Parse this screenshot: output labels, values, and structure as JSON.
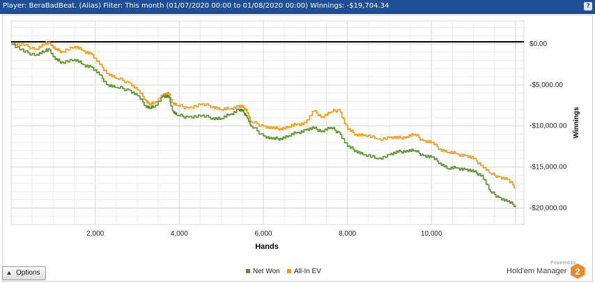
{
  "header": {
    "title": "Player: BeraBadBeat. (Alias) Filter: This month (01/07/2020 00:00 to 01/08/2020 00:00) Winnings: -$19,704.34",
    "help_icon": "question-icon"
  },
  "controls": {
    "options_label": "Options",
    "options_icon": "triangle-up-icon"
  },
  "legend": [
    {
      "name": "Net Won",
      "color": "#5a8f29"
    },
    {
      "name": "All-In EV",
      "color": "#f39a1e"
    }
  ],
  "brand": {
    "powered_by": "Powered by",
    "name": "Hold'em Manager",
    "badge": "2",
    "badge_color": "#f0852c"
  },
  "chart_data": {
    "type": "line",
    "xlabel": "Hands",
    "ylabel": "Winnings",
    "x_ticks": [
      "2,000",
      "4,000",
      "6,000",
      "8,000",
      "10,000"
    ],
    "x_tick_values": [
      2000,
      4000,
      6000,
      8000,
      10000
    ],
    "y_ticks": [
      "$0.00",
      "-$5,000.00",
      "-$10,000.00",
      "-$15,000.00",
      "-$20,000.00"
    ],
    "y_tick_values": [
      0,
      -5000,
      -10000,
      -15000,
      -20000
    ],
    "xlim": [
      0,
      12200
    ],
    "ylim": [
      -22000,
      2800
    ],
    "grid": true,
    "zero_line": true,
    "legend_position": "bottom",
    "series": [
      {
        "name": "Net Won",
        "color": "#5a8f29",
        "x": [
          0,
          300,
          600,
          800,
          900,
          1050,
          1200,
          1500,
          1700,
          1900,
          2100,
          2300,
          2500,
          2800,
          3000,
          3200,
          3300,
          3400,
          3600,
          3750,
          3850,
          3950,
          4200,
          4500,
          4800,
          5000,
          5200,
          5400,
          5500,
          5600,
          5700,
          6000,
          6200,
          6400,
          6600,
          6800,
          7000,
          7200,
          7400,
          7600,
          7800,
          8000,
          8200,
          8400,
          8700,
          9000,
          9200,
          9400,
          9600,
          9800,
          10000,
          10200,
          10400,
          10600,
          10800,
          11000,
          11200,
          11400,
          11600,
          11800,
          12000
        ],
        "y": [
          0,
          -1000,
          -1300,
          -900,
          -600,
          -1900,
          -2200,
          -1900,
          -2500,
          -2800,
          -3800,
          -5000,
          -5300,
          -5600,
          -6300,
          -7500,
          -7800,
          -7700,
          -6400,
          -6500,
          -8200,
          -8700,
          -8900,
          -8800,
          -9000,
          -9100,
          -8600,
          -8000,
          -8200,
          -8700,
          -10000,
          -11200,
          -11600,
          -11500,
          -11200,
          -10800,
          -10500,
          -10300,
          -10600,
          -10200,
          -10800,
          -12500,
          -13000,
          -13500,
          -14000,
          -13500,
          -13200,
          -13000,
          -13000,
          -13600,
          -13800,
          -14500,
          -15200,
          -15100,
          -15300,
          -15600,
          -16000,
          -18000,
          -18700,
          -19200,
          -19704
        ]
      },
      {
        "name": "All-In EV",
        "color": "#f39a1e",
        "x": [
          0,
          300,
          600,
          800,
          900,
          1050,
          1200,
          1500,
          1700,
          1900,
          2100,
          2300,
          2500,
          2800,
          3000,
          3200,
          3300,
          3400,
          3600,
          3750,
          3850,
          3950,
          4200,
          4500,
          4800,
          5000,
          5200,
          5400,
          5500,
          5600,
          5700,
          6000,
          6200,
          6400,
          6600,
          6800,
          7000,
          7200,
          7400,
          7600,
          7800,
          8000,
          8200,
          8400,
          8700,
          9000,
          9200,
          9400,
          9600,
          9800,
          10000,
          10200,
          10400,
          10600,
          10800,
          11000,
          11200,
          11400,
          11600,
          11800,
          12000
        ],
        "y": [
          0,
          -200,
          -600,
          0,
          200,
          -700,
          -900,
          -300,
          -800,
          -1200,
          -2500,
          -3600,
          -4200,
          -4700,
          -5600,
          -6800,
          -7400,
          -7200,
          -6200,
          -6100,
          -7200,
          -7500,
          -7800,
          -7400,
          -7600,
          -8000,
          -7900,
          -7600,
          -7700,
          -8000,
          -9500,
          -10000,
          -10300,
          -10300,
          -10100,
          -9800,
          -9600,
          -8200,
          -8900,
          -8300,
          -8000,
          -10400,
          -11000,
          -11100,
          -11600,
          -11400,
          -11500,
          -11300,
          -11000,
          -11800,
          -12000,
          -12800,
          -13200,
          -13400,
          -13600,
          -14000,
          -14800,
          -15800,
          -16200,
          -16500,
          -17500
        ]
      }
    ]
  }
}
